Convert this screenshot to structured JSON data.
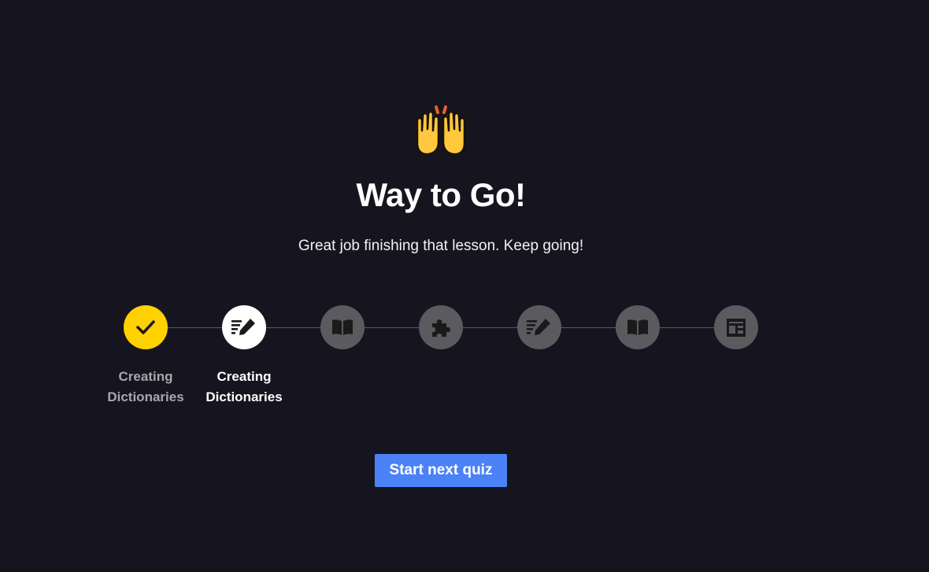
{
  "celebration": {
    "icon": "raising-hands-icon",
    "title": "Way to Go!",
    "subtitle": "Great job finishing that lesson. Keep going!"
  },
  "progress": {
    "steps": [
      {
        "icon": "check-icon",
        "state": "completed",
        "label": "Creating Dictionaries"
      },
      {
        "icon": "pencil-notes-icon",
        "state": "current",
        "label": "Creating Dictionaries"
      },
      {
        "icon": "open-book-icon",
        "state": "locked"
      },
      {
        "icon": "puzzle-piece-icon",
        "state": "locked"
      },
      {
        "icon": "pencil-notes-icon",
        "state": "locked"
      },
      {
        "icon": "open-book-icon",
        "state": "locked"
      },
      {
        "icon": "newspaper-icon",
        "state": "locked"
      }
    ]
  },
  "actions": {
    "start_next_quiz_label": "Start next quiz"
  },
  "colors": {
    "background": "#16151f",
    "completed_step": "#ffd100",
    "current_step": "#ffffff",
    "locked_step": "#5b5a5f",
    "primary_button": "#4c82f7"
  }
}
